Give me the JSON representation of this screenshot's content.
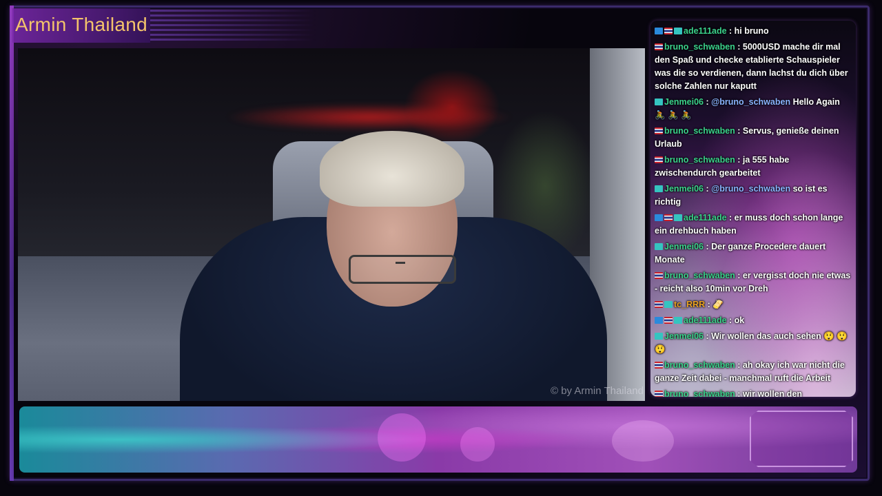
{
  "stream": {
    "title": "Armin Thailand",
    "watermark": "© by Armin Thailand"
  },
  "chat": {
    "messages": [
      {
        "badges": [
          "star-badge",
          "flag-badge",
          "sub-badge"
        ],
        "user": "ade111ade",
        "user_color": "#3bd28c",
        "mention": "",
        "text": "hi bruno"
      },
      {
        "badges": [
          "flag-badge"
        ],
        "user": "bruno_schwaben",
        "user_color": "#3bd28c",
        "mention": "",
        "text": "5000USD mache dir mal den Spaß und checke etablierte Schauspieler was die so verdienen, dann lachst du dich über solche Zahlen nur kaputt"
      },
      {
        "badges": [
          "sub-badge"
        ],
        "user": "Jenmei06",
        "user_color": "#3bd28c",
        "mention": "@bruno_schwaben",
        "text": "Hello Again 🚴 🚴 🚴"
      },
      {
        "badges": [
          "flag-badge"
        ],
        "user": "bruno_schwaben",
        "user_color": "#3bd28c",
        "mention": "",
        "text": "Servus, genieße deinen Urlaub"
      },
      {
        "badges": [
          "flag-badge"
        ],
        "user": "bruno_schwaben",
        "user_color": "#3bd28c",
        "mention": "",
        "text": "ja 555 habe zwischendurch gearbeitet"
      },
      {
        "badges": [
          "sub-badge"
        ],
        "user": "Jenmei06",
        "user_color": "#3bd28c",
        "mention": "@bruno_schwaben",
        "text": "so ist es richtig"
      },
      {
        "badges": [
          "star-badge",
          "flag-badge",
          "sub-badge"
        ],
        "user": "ade111ade",
        "user_color": "#3bd28c",
        "mention": "",
        "text": "er muss doch schon lange ein drehbuch haben"
      },
      {
        "badges": [
          "sub-badge"
        ],
        "user": "Jenmei06",
        "user_color": "#3bd28c",
        "mention": "",
        "text": "Der ganze Procedere dauert Monate"
      },
      {
        "badges": [
          "flag-badge"
        ],
        "user": "bruno_schwaben",
        "user_color": "#3bd28c",
        "mention": "",
        "text": "er vergisst doch nie etwas - reicht also 10min vor Dreh"
      },
      {
        "badges": [
          "flag-badge",
          "sub-badge"
        ],
        "user": "tc_RRR",
        "user_color": "#e8a020",
        "mention": "",
        "text": "🫔"
      },
      {
        "badges": [
          "star-badge",
          "flag-badge",
          "sub-badge"
        ],
        "user": "ade111ade",
        "user_color": "#3bd28c",
        "mention": "",
        "text": "ok"
      },
      {
        "badges": [
          "sub-badge"
        ],
        "user": "Jenmei06",
        "user_color": "#3bd28c",
        "mention": "",
        "text": "Wir wollen das auch sehen 😲 😲 😲"
      },
      {
        "badges": [
          "flag-badge"
        ],
        "user": "bruno_schwaben",
        "user_color": "#3bd28c",
        "mention": "",
        "text": "ah okay ich war nicht die ganze Zeit dabei - manchmal ruft die Arbeit"
      },
      {
        "badges": [
          "flag-badge"
        ],
        "user": "bruno_schwaben",
        "user_color": "#3bd28c",
        "mention": "",
        "text": "wir wollen den Meldemuschies doch keine Chance geben"
      }
    ]
  },
  "colors": {
    "title": "#f3c36b",
    "accent": "#9b3cc8",
    "username": "#3bd28c",
    "mention": "#8ab4ff"
  }
}
